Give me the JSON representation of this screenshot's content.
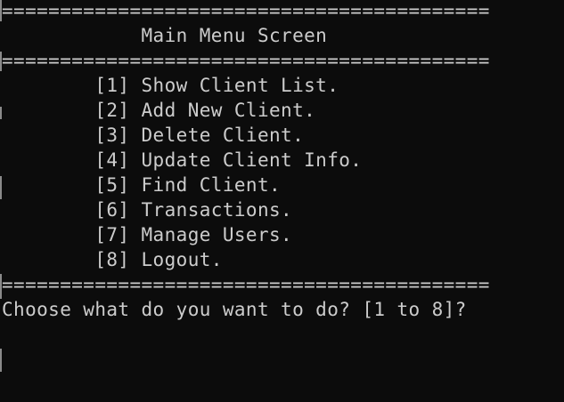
{
  "console": {
    "separator_top": "==========================================",
    "title": "            Main Menu Screen",
    "separator_mid": "==========================================",
    "menu_items": [
      "        [1] Show Client List.",
      "        [2] Add New Client.",
      "        [3] Delete Client.",
      "        [4] Update Client Info.",
      "        [5] Find Client.",
      "        [6] Transactions.",
      "        [7] Manage Users.",
      "        [8] Logout."
    ],
    "separator_bottom": "==========================================",
    "prompt": "Choose what do you want to do? [1 to 8]?"
  },
  "colors": {
    "background": "#0c0c0c",
    "text": "#cccccc"
  }
}
